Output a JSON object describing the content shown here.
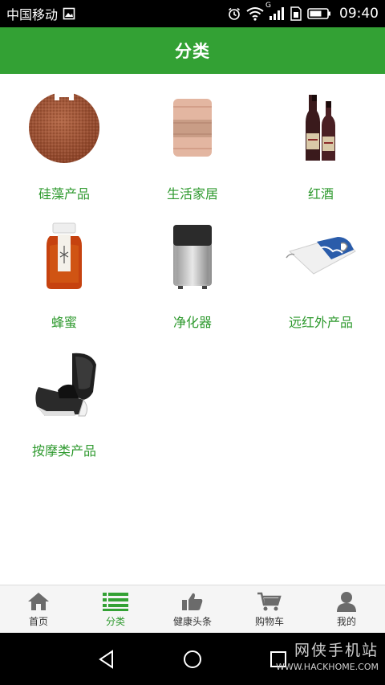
{
  "status_bar": {
    "carrier": "中国移动",
    "signal_label": "G",
    "time": "09:40"
  },
  "header": {
    "title": "分类"
  },
  "categories": [
    {
      "label": "硅藻产品",
      "icon": "diatom-disc-icon"
    },
    {
      "label": "生活家居",
      "icon": "towel-icon"
    },
    {
      "label": "红酒",
      "icon": "wine-bottles-icon"
    },
    {
      "label": "蜂蜜",
      "icon": "honey-jar-icon"
    },
    {
      "label": "净化器",
      "icon": "air-purifier-icon"
    },
    {
      "label": "远红外产品",
      "icon": "heating-pad-icon"
    },
    {
      "label": "按摩类产品",
      "icon": "massage-chair-icon"
    }
  ],
  "tabs": [
    {
      "label": "首页",
      "icon": "home-icon",
      "active": false
    },
    {
      "label": "分类",
      "icon": "list-icon",
      "active": true
    },
    {
      "label": "健康头条",
      "icon": "thumbs-up-icon",
      "active": false
    },
    {
      "label": "购物车",
      "icon": "cart-icon",
      "active": false
    },
    {
      "label": "我的",
      "icon": "user-icon",
      "active": false
    }
  ],
  "watermark": {
    "name": "网侠手机站",
    "url": "WWW.HACKHOME.COM"
  },
  "colors": {
    "brand_green": "#33a134",
    "label_green": "#2f9a2f",
    "tab_bar_bg": "#f5f5f5",
    "icon_gray": "#6b6b6b"
  }
}
